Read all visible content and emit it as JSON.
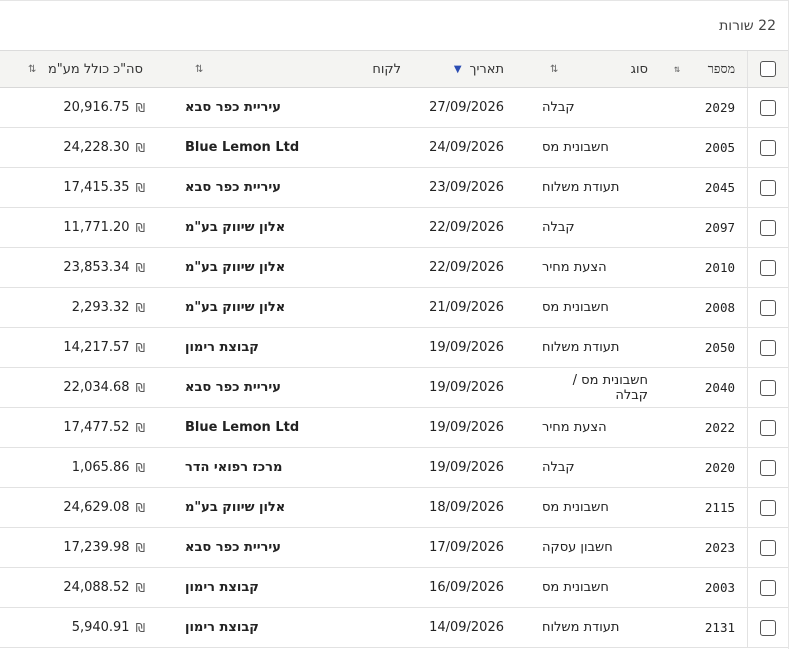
{
  "row_count_label": "22 שורות",
  "columns": {
    "number": "מספר",
    "type": "סוג",
    "date": "תאריך",
    "client": "לקוח",
    "total": "סה\"כ כולל מע\"מ"
  },
  "icons": {
    "sort": "sort-icon",
    "sort_desc": "sort-desc-icon",
    "shekel": "shekel-icon"
  },
  "currency_symbol": "₪",
  "rows": [
    {
      "number": "2029",
      "type": "קבלה",
      "date": "27/09/2026",
      "client": "עיריית כפר סבא",
      "total": "20,916.75"
    },
    {
      "number": "2005",
      "type": "חשבונית מס",
      "date": "24/09/2026",
      "client": "Blue Lemon Ltd",
      "total": "24,228.30"
    },
    {
      "number": "2045",
      "type": "תעודת משלוח",
      "date": "23/09/2026",
      "client": "עיריית כפר סבא",
      "total": "17,415.35"
    },
    {
      "number": "2097",
      "type": "קבלה",
      "date": "22/09/2026",
      "client": "אלון שיווק בע\"מ",
      "total": "11,771.20"
    },
    {
      "number": "2010",
      "type": "הצעת מחיר",
      "date": "22/09/2026",
      "client": "אלון שיווק בע\"מ",
      "total": "23,853.34"
    },
    {
      "number": "2008",
      "type": "חשבונית מס",
      "date": "21/09/2026",
      "client": "אלון שיווק בע\"מ",
      "total": "2,293.32"
    },
    {
      "number": "2050",
      "type": "תעודת משלוח",
      "date": "19/09/2026",
      "client": "קבוצת רימון",
      "total": "14,217.57"
    },
    {
      "number": "2040",
      "type": "חשבונית מס / קבלה",
      "date": "19/09/2026",
      "client": "עיריית כפר סבא",
      "total": "22,034.68"
    },
    {
      "number": "2022",
      "type": "הצעת מחיר",
      "date": "19/09/2026",
      "client": "Blue Lemon Ltd",
      "total": "17,477.52"
    },
    {
      "number": "2020",
      "type": "קבלה",
      "date": "19/09/2026",
      "client": "מרכז רפואי הדר",
      "total": "1,065.86"
    },
    {
      "number": "2115",
      "type": "חשבונית מס",
      "date": "18/09/2026",
      "client": "אלון שיווק בע\"מ",
      "total": "24,629.08"
    },
    {
      "number": "2023",
      "type": "חשבון עסקה",
      "date": "17/09/2026",
      "client": "עיריית כפר סבא",
      "total": "17,239.98"
    },
    {
      "number": "2003",
      "type": "חשבונית מס",
      "date": "16/09/2026",
      "client": "קבוצת רימון",
      "total": "24,088.52"
    },
    {
      "number": "2131",
      "type": "תעודת משלוח",
      "date": "14/09/2026",
      "client": "קבוצת רימון",
      "total": "5,940.91"
    }
  ]
}
